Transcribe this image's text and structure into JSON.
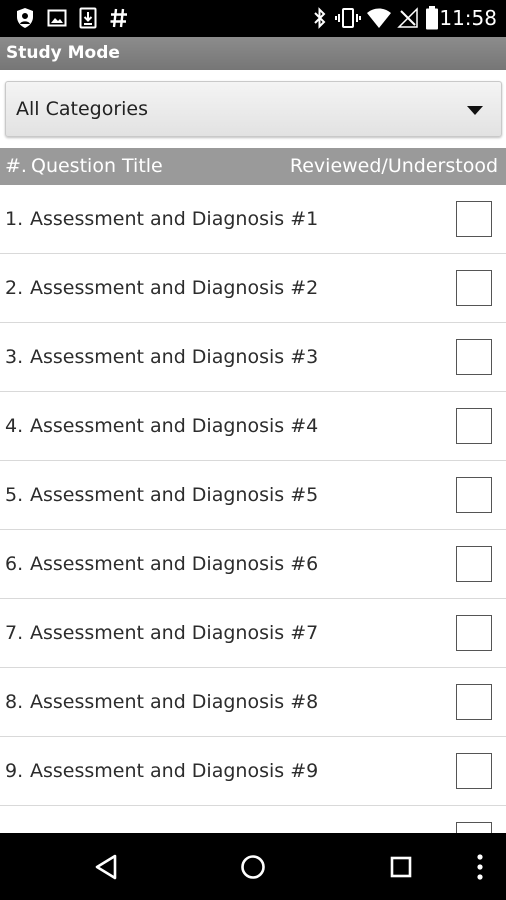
{
  "status_bar": {
    "time": "11:58",
    "left_icons": [
      "shield-icon",
      "image-icon",
      "download-icon",
      "hash-icon"
    ],
    "right_icons": [
      "bluetooth-icon",
      "vibrate-icon",
      "wifi-icon",
      "no-signal-icon",
      "battery-icon"
    ]
  },
  "app": {
    "title": "Study Mode"
  },
  "category_selector": {
    "selected": "All Categories"
  },
  "table_header": {
    "number": "#.",
    "title": "Question Title",
    "status": "Reviewed/Understood"
  },
  "questions": [
    {
      "number": "1.",
      "title": "Assessment and Diagnosis #1",
      "checked": false
    },
    {
      "number": "2.",
      "title": "Assessment and Diagnosis #2",
      "checked": false
    },
    {
      "number": "3.",
      "title": "Assessment and Diagnosis #3",
      "checked": false
    },
    {
      "number": "4.",
      "title": "Assessment and Diagnosis #4",
      "checked": false
    },
    {
      "number": "5.",
      "title": "Assessment and Diagnosis #5",
      "checked": false
    },
    {
      "number": "6.",
      "title": "Assessment and Diagnosis #6",
      "checked": false
    },
    {
      "number": "7.",
      "title": "Assessment and Diagnosis #7",
      "checked": false
    },
    {
      "number": "8.",
      "title": "Assessment and Diagnosis #8",
      "checked": false
    },
    {
      "number": "9.",
      "title": "Assessment and Diagnosis #9",
      "checked": false
    },
    {
      "number": "",
      "title": "",
      "checked": false
    }
  ],
  "nav_bar": {
    "icons": [
      "back-icon",
      "home-icon",
      "recents-icon",
      "overflow-menu-icon"
    ]
  },
  "colors": {
    "title_bar": "#808080",
    "header_row": "#9a9a9a",
    "status_bar": "#000000"
  }
}
